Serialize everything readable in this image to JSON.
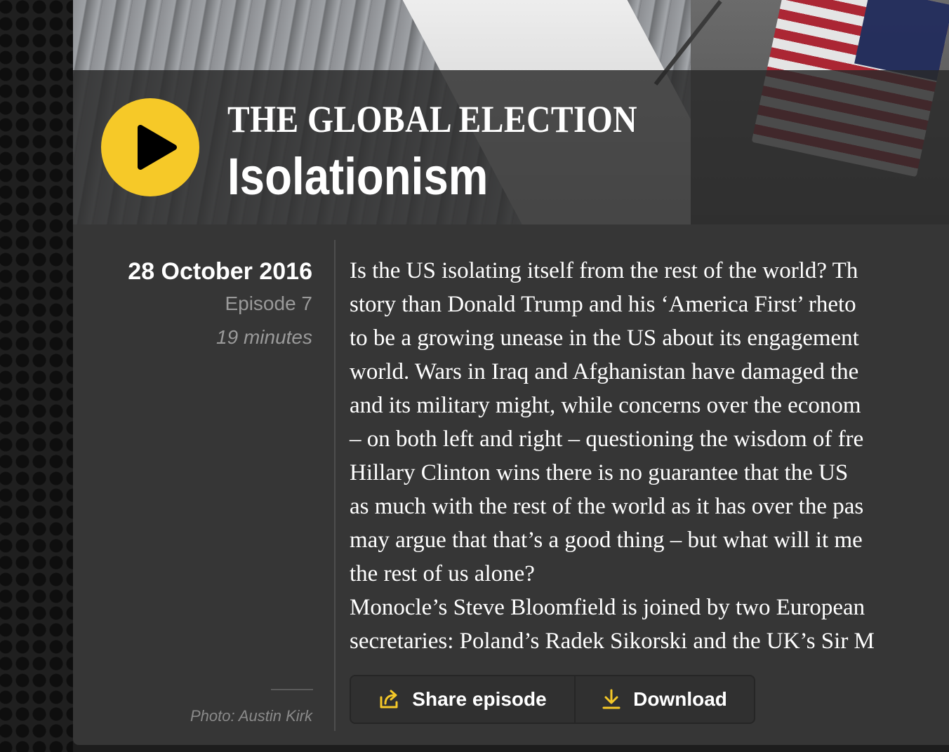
{
  "hero": {
    "series_title": "THE GLOBAL ELECTION",
    "episode_title": "Isolationism",
    "play_icon": "play-icon"
  },
  "meta": {
    "date": "28 October 2016",
    "episode": "Episode 7",
    "duration": "19 minutes",
    "photo_credit": "Photo: Austin Kirk"
  },
  "description": {
    "lines": [
      "Is the US isolating itself from the rest of the world? Th",
      "story than Donald Trump and his ‘America First’ rheto",
      "to be a growing unease in the US about its engagement",
      "world. Wars in Iraq and Afghanistan have damaged the",
      "and its military might, while concerns over the econom",
      "– on both left and right – questioning the wisdom of fre",
      "Hillary Clinton wins there is no guarantee that the US",
      "as much with the rest of the world as it has over the pas",
      "may argue that that’s a good thing – but what will it me",
      "the rest of us alone?",
      "Monocle’s Steve Bloomfield is joined by two European",
      "secretaries: Poland’s Radek Sikorski and the UK’s Sir M"
    ]
  },
  "actions": {
    "share_label": "Share episode",
    "share_icon": "share-icon",
    "download_label": "Download",
    "download_icon": "download-icon"
  },
  "colors": {
    "accent": "#f6c928",
    "card_bg": "#363636",
    "page_bg": "#1d1d1d",
    "text": "#ffffff",
    "muted": "#9a9a9a"
  }
}
